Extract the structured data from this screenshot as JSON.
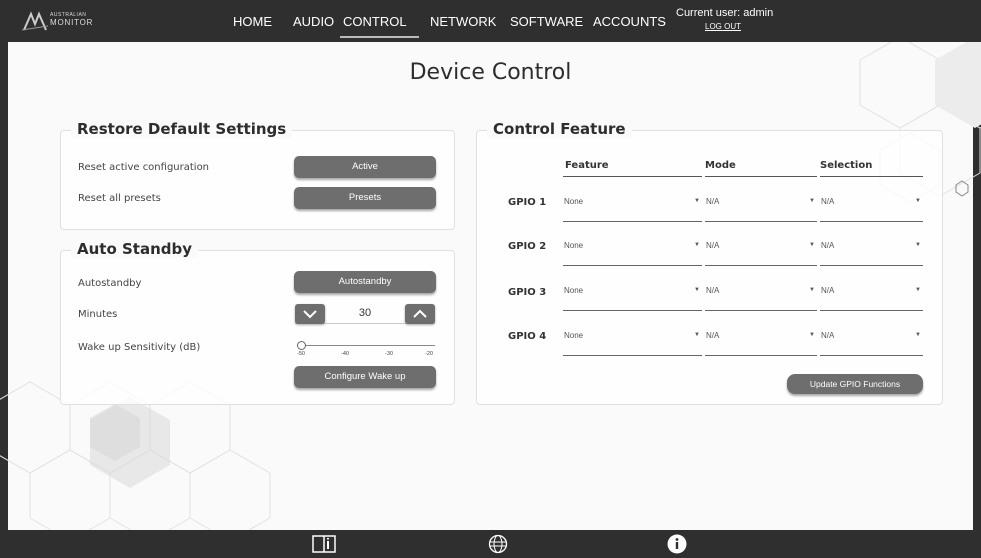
{
  "app": {
    "logo_top": "AUSTRALIAN",
    "logo_bottom": "MONITOR"
  },
  "nav": {
    "home": "HOME",
    "audio": "AUDIO",
    "control": "CONTROL",
    "network": "NETWORK",
    "software": "SOFTWARE",
    "accounts": "ACCOUNTS",
    "active": "CONTROL",
    "user": "Current user: admin",
    "logout": "LOG OUT"
  },
  "page": {
    "title": "Device Control"
  },
  "restore": {
    "title": "Restore Default Settings",
    "reset_active_label": "Reset active configuration",
    "reset_active_button": "Active",
    "reset_presets_label": "Reset all presets",
    "reset_presets_button": "Presets"
  },
  "standby": {
    "title": "Auto Standby",
    "autostandby_label": "Autostandby",
    "autostandby_button": "Autostandby",
    "minutes_label": "Minutes",
    "minutes_value": "30",
    "wake_label": "Wake up Sensitivity (dB)",
    "wake_ticks": [
      "-50",
      "-40",
      "-30",
      "-20"
    ],
    "wake_value": -50,
    "configure_button": "Configure Wake up"
  },
  "control": {
    "title": "Control Feature",
    "headers": {
      "feature": "Feature",
      "mode": "Mode",
      "selection": "Selection"
    },
    "rows": [
      {
        "label": "GPIO 1",
        "feature": "None",
        "mode": "N/A",
        "selection": "N/A"
      },
      {
        "label": "GPIO 2",
        "feature": "None",
        "mode": "N/A",
        "selection": "N/A"
      },
      {
        "label": "GPIO 3",
        "feature": "None",
        "mode": "N/A",
        "selection": "N/A"
      },
      {
        "label": "GPIO 4",
        "feature": "None",
        "mode": "N/A",
        "selection": "N/A"
      }
    ],
    "update_button": "Update GPIO Functions"
  },
  "footer": {
    "icons": [
      "manual-book-icon",
      "globe-icon",
      "info-icon"
    ]
  },
  "colors": {
    "nav_bg": "#2f2f2f",
    "button_bg": "#6e6e6e",
    "page_bg": "#fafafa"
  }
}
